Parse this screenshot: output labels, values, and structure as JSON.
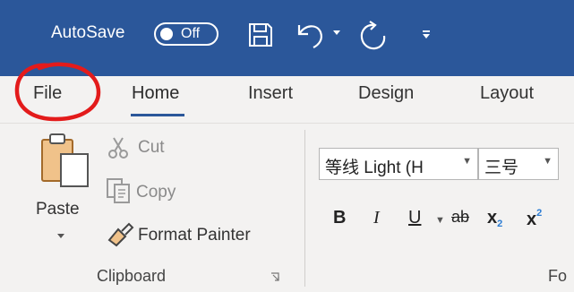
{
  "titlebar": {
    "autosave_label": "AutoSave",
    "autosave_state": "Off",
    "qat_icons": [
      "save-icon",
      "undo-icon",
      "undo-dropdown-icon",
      "redo-icon",
      "customize-qat-icon"
    ],
    "bar_color": "#2b579a"
  },
  "tabs": [
    {
      "label": "File"
    },
    {
      "label": "Home"
    },
    {
      "label": "Insert"
    },
    {
      "label": "Design"
    },
    {
      "label": "Layout"
    }
  ],
  "active_tab": "Home",
  "annotation": {
    "color": "#e31b1b",
    "shape": "hand-drawn-circle",
    "target": "File"
  },
  "clipboard": {
    "paste_label": "Paste",
    "cut_label": "Cut",
    "copy_label": "Copy",
    "format_painter_label": "Format Painter",
    "group_label": "Clipboard"
  },
  "font": {
    "font_name_value": "等线 Light (H",
    "font_size_value": "三号",
    "bold_glyph": "B",
    "italic_glyph": "I",
    "underline_glyph": "U",
    "strike_glyph": "ab",
    "subscript_glyph": "x",
    "subscript_mark": "2",
    "superscript_glyph": "x",
    "superscript_mark": "2",
    "group_label_partial": "Fo"
  }
}
